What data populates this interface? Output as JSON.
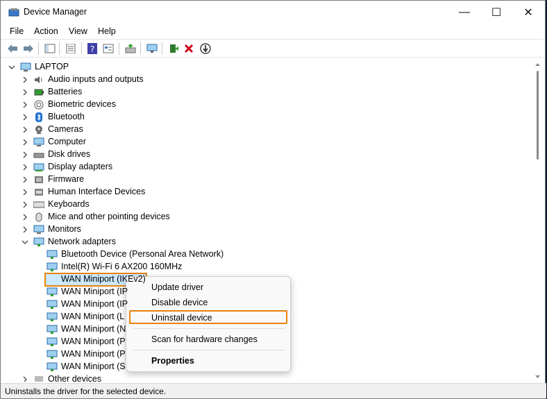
{
  "window": {
    "title": "Device Manager"
  },
  "menu": [
    "File",
    "Action",
    "View",
    "Help"
  ],
  "toolbar_icons": [
    "back-icon",
    "forward-icon",
    "show-hide-tree-icon",
    "properties-icon",
    "help-icon",
    "device-view-icon",
    "update-driver-icon",
    "scan-hardware-icon",
    "enable-device-icon",
    "uninstall-device-icon",
    "disable-device-icon"
  ],
  "tree": {
    "root": "LAPTOP",
    "categories": [
      {
        "label": "Audio inputs and outputs",
        "icon": "speaker-icon"
      },
      {
        "label": "Batteries",
        "icon": "battery-icon"
      },
      {
        "label": "Biometric devices",
        "icon": "fingerprint-icon"
      },
      {
        "label": "Bluetooth",
        "icon": "bluetooth-icon"
      },
      {
        "label": "Cameras",
        "icon": "camera-icon"
      },
      {
        "label": "Computer",
        "icon": "monitor-icon"
      },
      {
        "label": "Disk drives",
        "icon": "disk-icon"
      },
      {
        "label": "Display adapters",
        "icon": "display-adapter-icon"
      },
      {
        "label": "Firmware",
        "icon": "firmware-icon"
      },
      {
        "label": "Human Interface Devices",
        "icon": "hid-icon"
      },
      {
        "label": "Keyboards",
        "icon": "keyboard-icon"
      },
      {
        "label": "Mice and other pointing devices",
        "icon": "mouse-icon"
      },
      {
        "label": "Monitors",
        "icon": "monitor-icon"
      },
      {
        "label": "Network adapters",
        "icon": "network-icon"
      }
    ],
    "network_children": [
      "Bluetooth Device (Personal Area Network)",
      "Intel(R) Wi-Fi 6 AX200 160MHz",
      "WAN Miniport (IKEv2)",
      "WAN Miniport (IP)",
      "WAN Miniport (IPv6)",
      "WAN Miniport (L2TP)",
      "WAN Miniport (Network Monitor)",
      "WAN Miniport (PPPOE)",
      "WAN Miniport (PPTP)",
      "WAN Miniport (SSTP)"
    ],
    "network_children_visible": [
      "Bluetooth Device (Personal Area Network)",
      "Intel(R) Wi-Fi 6 AX200 160MHz",
      "WAN Miniport (IKEv2)",
      "WAN Miniport (IP",
      "WAN Miniport (IP",
      "WAN Miniport (L",
      "WAN Miniport (N",
      "WAN Miniport (P",
      "WAN Miniport (P",
      "WAN Miniport (S"
    ],
    "after": "Other devices"
  },
  "context_menu": {
    "items": [
      "Update driver",
      "Disable device",
      "Uninstall device",
      "Scan for hardware changes",
      "Properties"
    ],
    "highlighted": "Uninstall device"
  },
  "status": "Uninstalls the driver for the selected device.",
  "colors": {
    "highlight": "#e8820c",
    "selection": "#cce8ff"
  }
}
